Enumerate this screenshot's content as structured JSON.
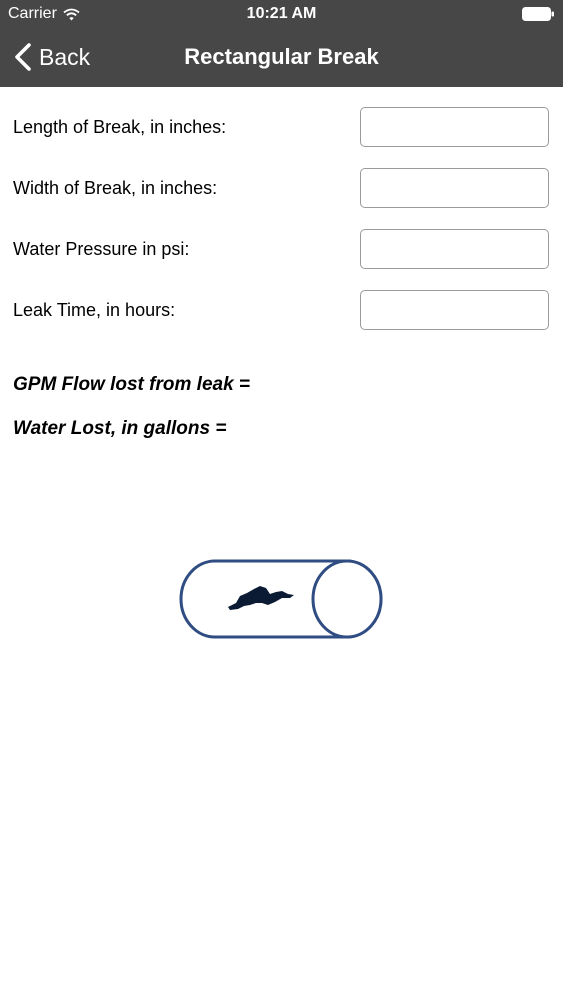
{
  "status_bar": {
    "carrier": "Carrier",
    "time": "10:21 AM"
  },
  "nav": {
    "back_label": "Back",
    "title": "Rectangular Break"
  },
  "fields": [
    {
      "label": "Length of Break, in inches:",
      "value": ""
    },
    {
      "label": "Width of Break, in inches:",
      "value": ""
    },
    {
      "label": "Water Pressure in psi:",
      "value": ""
    },
    {
      "label": "Leak Time, in hours:",
      "value": ""
    }
  ],
  "results": {
    "gpm_label": "GPM Flow lost from leak =",
    "water_lost_label": "Water Lost, in gallons ="
  },
  "colors": {
    "nav_bar": "#474747",
    "pipe_stroke": "#2f4d82",
    "leak_fill": "#0a1b33"
  },
  "icons": {
    "back": "chevron-left-icon",
    "wifi": "wifi-icon",
    "battery": "battery-icon",
    "illustration": "pipe-leak-illustration"
  }
}
